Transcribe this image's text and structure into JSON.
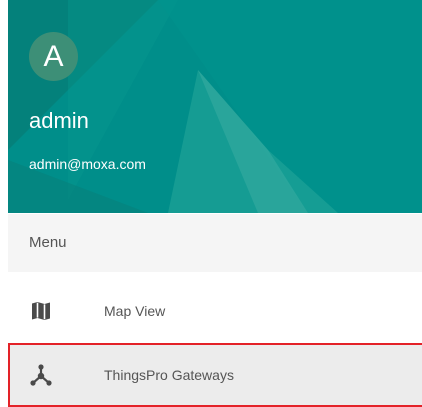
{
  "user": {
    "avatar_letter": "A",
    "name": "admin",
    "email": "admin@moxa.com"
  },
  "menu": {
    "header": "Menu",
    "items": [
      {
        "label": "Map View",
        "icon": "map-icon"
      },
      {
        "label": "ThingsPro Gateways",
        "icon": "gateway-hub-icon",
        "selected": true
      }
    ]
  },
  "colors": {
    "header_bg": "#008e8a",
    "avatar_bg": "#3d8f77",
    "selection_border": "#e32228"
  }
}
